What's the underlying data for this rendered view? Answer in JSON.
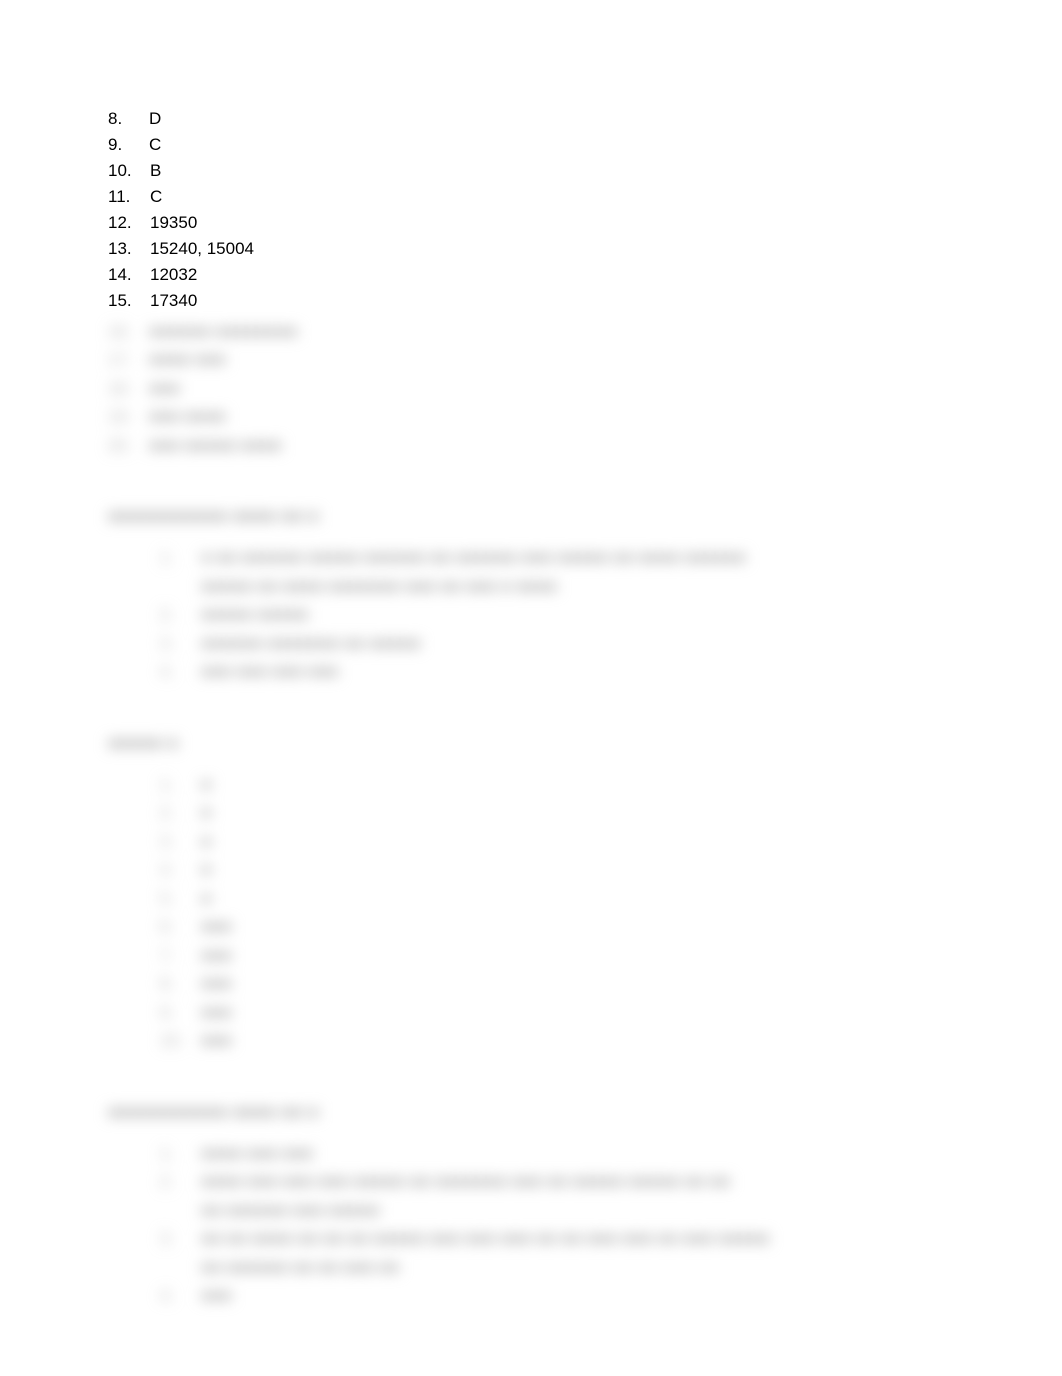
{
  "visible_items": [
    {
      "number": "8.",
      "answer": "D"
    },
    {
      "number": "9.",
      "answer": "C"
    },
    {
      "number": "10.",
      "answer": "B"
    },
    {
      "number": "11.",
      "answer": "C"
    },
    {
      "number": "12.",
      "answer": "19350"
    },
    {
      "number": "13.",
      "answer": "15240, 15004"
    },
    {
      "number": "14.",
      "answer": "12032"
    },
    {
      "number": "15.",
      "answer": "17340"
    }
  ],
  "blurred_block_1": [
    {
      "n": "16.",
      "t": "■■■■■■  ■■■■■■■■"
    },
    {
      "n": "17.",
      "t": "■■■■  ■■■"
    },
    {
      "n": "18.",
      "t": "■■■"
    },
    {
      "n": "19.",
      "t": "■■■  ■■■■"
    },
    {
      "n": "20.",
      "t": "■■■  ■■■■■  ■■■■"
    }
  ],
  "heading_1": "■■■■■■■■■■■ ■■■■ ■■ ■",
  "blurred_block_2": [
    {
      "n": "1.",
      "t": "■   ■■ ■■■■■■ ■■■■■ ■■■■■■ ■■ ■■■■■■ ■■■ ■■■■■   ■■  ■■■■ ■■■■■■"
    },
    {
      "n": "",
      "t": "■■■■■ ■■ ■■■■ ■■■■■■■  ■■■ ■■ ■■■ ■ ■■■■"
    },
    {
      "n": "2.",
      "t": "■■■■■ ■■■■■"
    },
    {
      "n": "3.",
      "t": "■■■■■■ ■■■■■■■  ■■ ■■■■■"
    },
    {
      "n": "4.",
      "t": "■■■  ■■■  ■■■  ■■■"
    }
  ],
  "heading_2": "■■■■■ ■",
  "blurred_block_3": [
    {
      "n": "1.",
      "t": "■"
    },
    {
      "n": "2.",
      "t": "■"
    },
    {
      "n": "3.",
      "t": "■"
    },
    {
      "n": "4.",
      "t": "■"
    },
    {
      "n": "5.",
      "t": "■"
    },
    {
      "n": "6.",
      "t": "■■■"
    },
    {
      "n": "7.",
      "t": "■■■"
    },
    {
      "n": "8.",
      "t": "■■■"
    },
    {
      "n": "9.",
      "t": "■■■"
    },
    {
      "n": "10.",
      "t": "■■■"
    }
  ],
  "heading_3": "■■■■■■■■■■■ ■■■■ ■■ ■",
  "blurred_block_4": [
    {
      "n": "1.",
      "t": "■■■■ ■■■ ■■■"
    },
    {
      "n": "2.",
      "t": "■■■■ ■■■  ■■■ ■■■ ■■■■■ ■■ ■■■■■■■  ■■■ ■■ ■■■■■ ■■■■■ ■■  ■■"
    },
    {
      "n": "",
      "t": "■■ ■■■■■■ ■■■ ■■■■■"
    },
    {
      "n": "3.",
      "t": "■■ ■■ ■■■■ ■■ ■■ ■■ ■■■■■ ■■■ ■■■ ■■■ ■■ ■■ ■■■ ■■■ ■■ ■■■ ■■■■■"
    },
    {
      "n": "",
      "t": "■■ ■■■■■■ ■■ ■■ ■■■ ■■"
    },
    {
      "n": "4.",
      "t": "■■■"
    }
  ]
}
